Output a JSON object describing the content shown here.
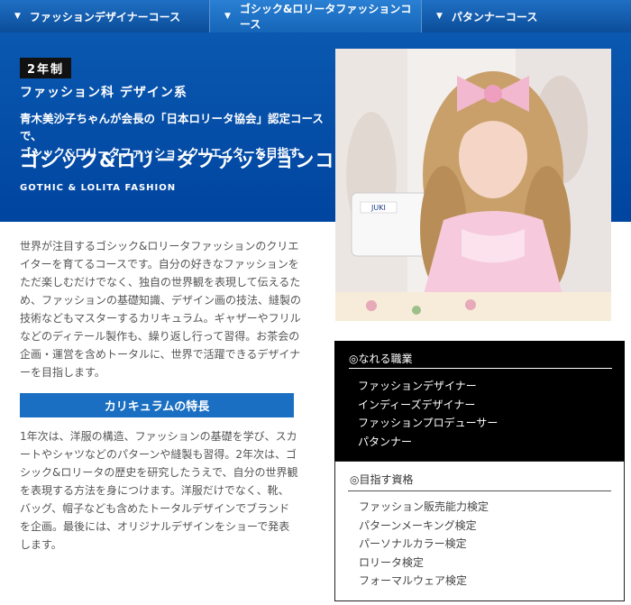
{
  "tabs": [
    {
      "label": "ファッションデザイナーコース"
    },
    {
      "label": "ゴシック&ロリータファッションコース"
    },
    {
      "label": "パタンナーコース"
    }
  ],
  "hero": {
    "badge": "2年制",
    "department": "ファッション科 デザイン系",
    "tagline_line1": "青木美沙子ちゃんが会長の「日本ロリータ協会」認定コースで、",
    "tagline_line2": "ゴシック&ロリータファッションクリエイターを目指す。",
    "title": "ゴシック&ロリータファッションコース",
    "title_en": "GOTHIC & LOLITA FASHION"
  },
  "intro": "世界が注目するゴシック&ロリータファッションのクリエイターを育てるコースです。自分の好きなファッションをただ楽しむだけでなく、独自の世界観を表現して伝えるため、ファッションの基礎知識、デザイン画の技法、縫製の技術などもマスターするカリキュラム。ギャザーやフリルなどのディテール製作も、繰り返し行って習得。お茶会の企画・運営を含めトータルに、世界で活躍できるデザイナーを目指します。",
  "curriculum": {
    "heading": "カリキュラムの特長",
    "text": "1年次は、洋服の構造、ファッションの基礎を学び、スカートやシャツなどのパターンや縫製も習得。2年次は、ゴシック&ロリータの歴史を研究したうえで、自分の世界観を表現する方法を身につけます。洋服だけでなく、靴、バッグ、帽子なども含めたトータルデザインでブランドを企画。最後には、オリジナルデザインをショーで発表します。"
  },
  "jobs": {
    "title": "◎なれる職業",
    "items": [
      "ファッションデザイナー",
      "インディーズデザイナー",
      "ファッションプロデューサー",
      "パタンナー"
    ]
  },
  "quals": {
    "title": "◎目指す資格",
    "items": [
      "ファッション販売能力検定",
      "パターンメーキング検定",
      "パーソナルカラー検定",
      "ロリータ検定",
      "フォーマルウェア検定"
    ]
  },
  "photo": {
    "label": "JUKI"
  },
  "colors": {
    "tab_bg": "#0b4d9a",
    "hero_bg": "#0052a8",
    "section_head": "#1a6fc2",
    "jobs_bg": "#000000"
  }
}
